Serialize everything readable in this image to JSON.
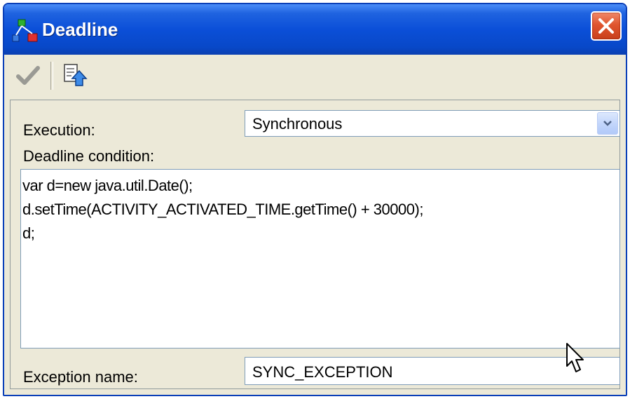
{
  "window": {
    "title": "Deadline",
    "title_icon": "workflow-icon",
    "close_icon": "close-icon"
  },
  "toolbar": {
    "items": [
      {
        "icon": "checkmark-icon",
        "enabled": false
      },
      {
        "icon": "export-document-icon",
        "enabled": true
      }
    ]
  },
  "form": {
    "execution_label": "Execution:",
    "execution_value": "Synchronous",
    "condition_label": "Deadline condition:",
    "condition_lines": [
      "var d=new java.util.Date();",
      "d.setTime(ACTIVITY_ACTIVATED_TIME.getTime() + 30000);",
      "d;"
    ],
    "exception_label": "Exception name:",
    "exception_value": "SYNC_EXCEPTION"
  },
  "colors": {
    "titlebar": "#0b4fd8",
    "window_bg": "#ece9d8",
    "close_button": "#e0552e",
    "field_border": "#7f9db9"
  }
}
